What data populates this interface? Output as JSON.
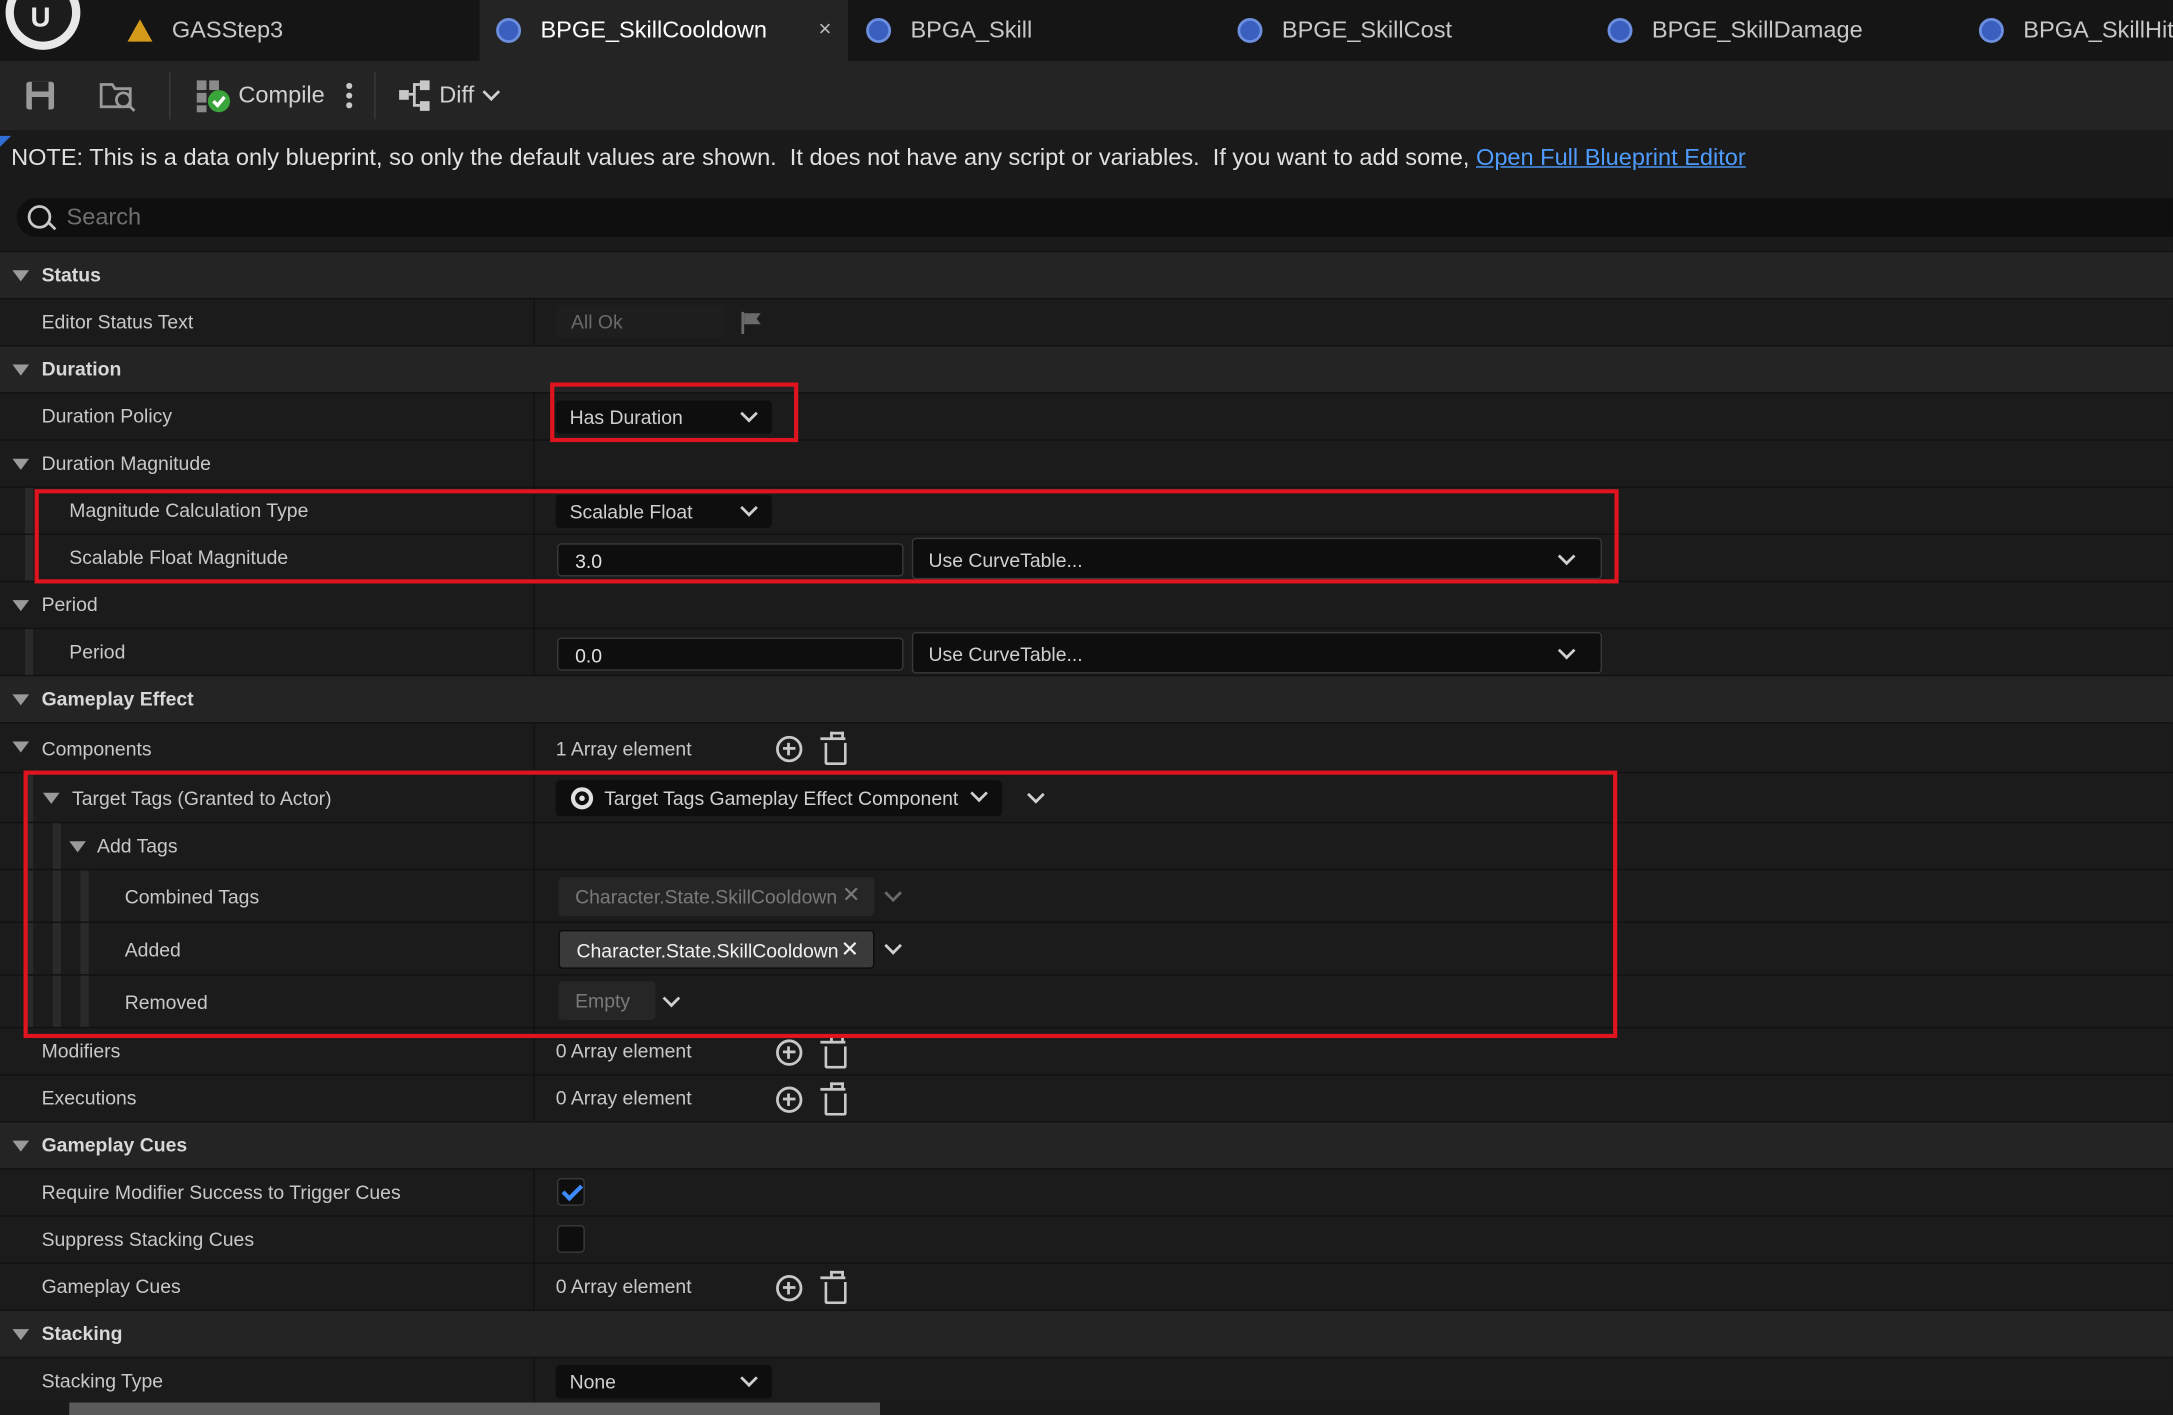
{
  "tabs": [
    {
      "label": "GASStep3",
      "icon": "level-warning-icon"
    },
    {
      "label": "BPGE_SkillCooldown",
      "icon": "blueprint-icon",
      "active": true,
      "close": "×"
    },
    {
      "label": "BPGA_Skill",
      "icon": "blueprint-icon"
    },
    {
      "label": "BPGE_SkillCost",
      "icon": "blueprint-icon"
    },
    {
      "label": "BPGE_SkillDamage",
      "icon": "blueprint-icon"
    },
    {
      "label": "BPGA_SkillHit",
      "icon": "blueprint-icon"
    }
  ],
  "toolbar": {
    "compile": "Compile",
    "diff": "Diff"
  },
  "note": {
    "text": "NOTE: This is a data only blueprint, so only the default values are shown.  It does not have any script or variables.  If you want to add some, ",
    "link": "Open Full Blueprint Editor"
  },
  "search": {
    "placeholder": "Search"
  },
  "sections": {
    "status": "Status",
    "duration": "Duration",
    "gameplay_effect": "Gameplay Effect",
    "gameplay_cues": "Gameplay Cues",
    "stacking": "Stacking"
  },
  "props": {
    "editor_status_text": {
      "label": "Editor Status Text",
      "value": "All Ok"
    },
    "duration_policy": {
      "label": "Duration Policy",
      "value": "Has Duration"
    },
    "duration_magnitude": {
      "label": "Duration Magnitude"
    },
    "magnitude_calc_type": {
      "label": "Magnitude Calculation Type",
      "value": "Scalable Float"
    },
    "scalable_float": {
      "label": "Scalable Float Magnitude",
      "value": "3.0",
      "curve": "Use CurveTable..."
    },
    "period_group": {
      "label": "Period"
    },
    "period": {
      "label": "Period",
      "value": "0.0",
      "curve": "Use CurveTable..."
    },
    "components": {
      "label": "Components",
      "value": "1 Array element"
    },
    "target_tags": {
      "label": "Target Tags (Granted to Actor)",
      "value": "Target Tags Gameplay Effect Component"
    },
    "add_tags": {
      "label": "Add Tags"
    },
    "combined_tags": {
      "label": "Combined Tags",
      "value": "Character.State.SkillCooldown"
    },
    "added": {
      "label": "Added",
      "value": "Character.State.SkillCooldown"
    },
    "removed": {
      "label": "Removed",
      "value": "Empty"
    },
    "modifiers": {
      "label": "Modifiers",
      "value": "0 Array element"
    },
    "executions": {
      "label": "Executions",
      "value": "0 Array element"
    },
    "require_modifier": {
      "label": "Require Modifier Success to Trigger Cues",
      "checked": true
    },
    "suppress_stacking": {
      "label": "Suppress Stacking Cues",
      "checked": false
    },
    "gameplay_cues": {
      "label": "Gameplay Cues",
      "value": "0 Array element"
    },
    "stacking_type": {
      "label": "Stacking Type",
      "value": "None"
    }
  },
  "colors": {
    "highlight": "#e0141e",
    "accent": "#3c8cff",
    "link": "#4f9cff"
  }
}
